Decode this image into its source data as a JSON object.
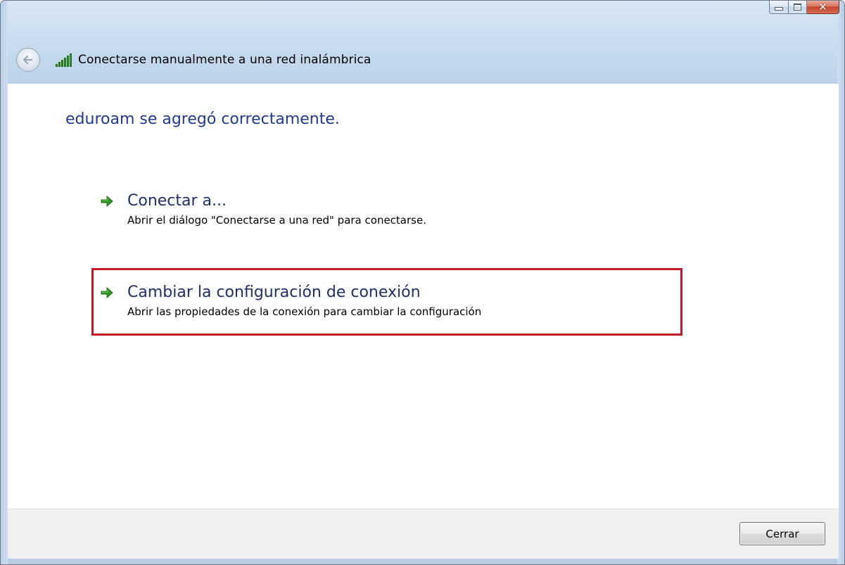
{
  "window": {
    "title": "Conectarse manualmente a una red inalámbrica",
    "icon": "wifi-signal-icon"
  },
  "caption_buttons": {
    "minimize_icon": "minimize-icon",
    "maximize_icon": "maximize-icon",
    "close_icon": "close-icon",
    "close_glyph": "✕"
  },
  "content": {
    "heading": "eduroam se agregó correctamente.",
    "options": [
      {
        "title": "Conectar a...",
        "description": "Abrir el diálogo \"Conectarse a una red\" para conectarse.",
        "icon": "green-arrow-icon"
      },
      {
        "title": "Cambiar la configuración de conexión",
        "description": "Abrir las propiedades de la conexión para cambiar la configuración",
        "icon": "green-arrow-icon",
        "highlighted": true
      }
    ]
  },
  "footer": {
    "close_label": "Cerrar"
  },
  "colors": {
    "heading": "#1f3a93",
    "option_title": "#1f2f6e",
    "highlight": "#c4182b",
    "arrow": "#2e9a23"
  }
}
